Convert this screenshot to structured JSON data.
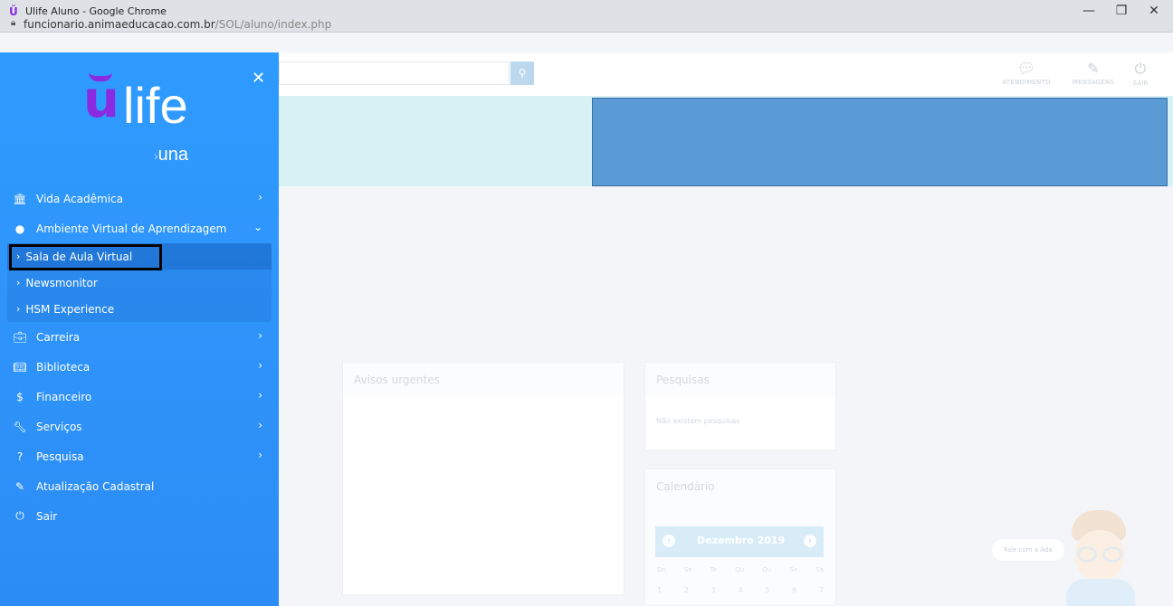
{
  "window": {
    "title": "Ulife Aluno - Google Chrome",
    "url_host": "funcionario.animaeducacao.com.br",
    "url_path": "/SOL/aluno/index.php"
  },
  "sidebar": {
    "logo": {
      "text": "life",
      "sub": "una"
    },
    "menu": [
      {
        "label": "Vida Acadêmica",
        "icon": "building-icon"
      },
      {
        "label": "Ambiente Virtual de Aprendizagem",
        "icon": "globe-icon",
        "expanded": true
      },
      {
        "label": "Carreira",
        "icon": "briefcase-icon"
      },
      {
        "label": "Biblioteca",
        "icon": "book-icon"
      },
      {
        "label": "Financeiro",
        "icon": "dollar-icon"
      },
      {
        "label": "Serviços",
        "icon": "wrench-icon"
      },
      {
        "label": "Pesquisa",
        "icon": "question-icon"
      },
      {
        "label": "Atualização Cadastral",
        "icon": "edit-icon"
      },
      {
        "label": "Sair",
        "icon": "power-icon"
      }
    ],
    "submenu": [
      {
        "label": "Sala de Aula Virtual",
        "active": true
      },
      {
        "label": "Newsmonitor"
      },
      {
        "label": "HSM Experience"
      }
    ]
  },
  "topbar": {
    "actions": [
      {
        "label": "ATENDIMENTO",
        "icon": "chat-icon"
      },
      {
        "label": "MENSAGENS",
        "icon": "edit-icon"
      },
      {
        "label": "SAIR",
        "icon": "power-icon"
      }
    ]
  },
  "cards": {
    "avisos_title": "Avisos urgentes",
    "pesquisas_title": "Pesquisas",
    "pesquisas_empty": "Não existem pesquisas",
    "calendario_title": "Calendário",
    "calendar_month": "Dezembro 2019",
    "weekdays": [
      "Do",
      "Se",
      "Te",
      "Qu",
      "Qu",
      "Se",
      "Sa"
    ],
    "days": [
      "1",
      "2",
      "3",
      "4",
      "5",
      "6",
      "7"
    ]
  },
  "chat": {
    "bubble": "Fale com a Ada"
  }
}
